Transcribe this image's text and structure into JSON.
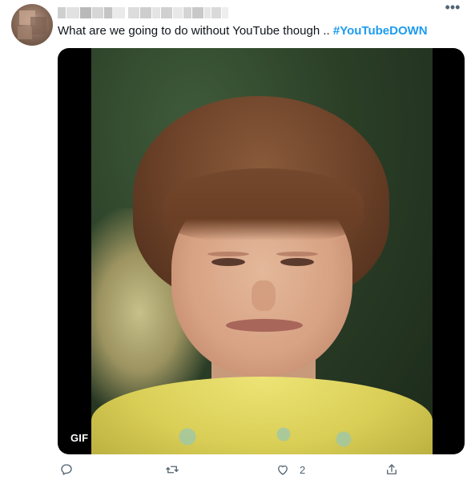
{
  "tweet": {
    "text": "What are we going to do without YouTube though .. ",
    "hashtag": "#YouTubeDOWN",
    "more_glyph": "•••",
    "media": {
      "badge": "GIF",
      "icon": "gif-badge"
    },
    "actions": {
      "reply": {
        "icon": "reply-icon",
        "count": ""
      },
      "retweet": {
        "icon": "retweet-icon",
        "count": ""
      },
      "like": {
        "icon": "like-icon",
        "count": "2"
      },
      "share": {
        "icon": "share-icon",
        "count": ""
      }
    }
  },
  "colors": {
    "accent": "#1d9bf0",
    "text": "#0f1419",
    "secondary": "#536471"
  }
}
